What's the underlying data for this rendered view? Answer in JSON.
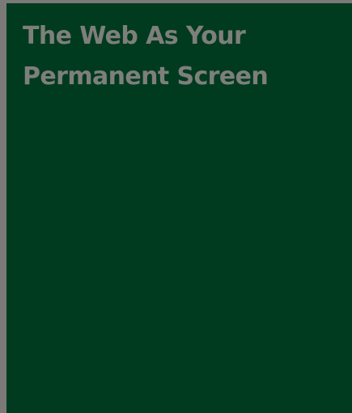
{
  "hero": {
    "title_line_1": "The Web As Your",
    "title_line_2": "Permanent Screen"
  },
  "colors": {
    "page_border": "#7a7a78",
    "panel_background": "#003b1f",
    "title_text": "#7e7f7b"
  }
}
